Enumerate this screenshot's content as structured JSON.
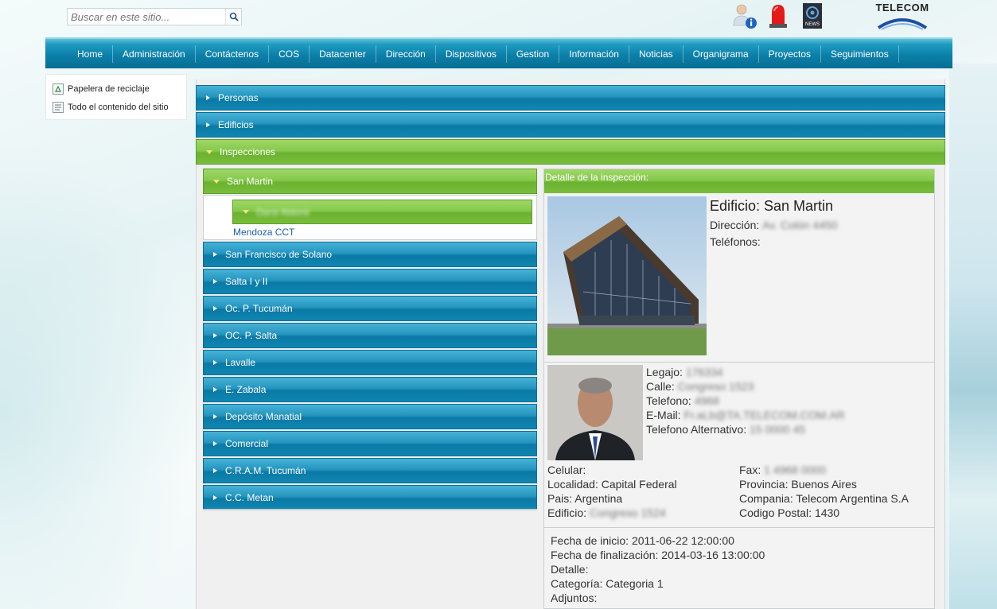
{
  "search": {
    "placeholder": "Buscar en este sitio..."
  },
  "header": {
    "icons": [
      "user-info-icon",
      "alarm-siren-icon",
      "news-icon"
    ],
    "logo_text": "TELECOM"
  },
  "nav": {
    "items": [
      "Home",
      "Administración",
      "Contáctenos",
      "COS",
      "Datacenter",
      "Dirección",
      "Dispositivos",
      "Gestion",
      "Información",
      "Noticias",
      "Organigrama",
      "Proyectos",
      "Seguimientos"
    ]
  },
  "quick_links": {
    "recycle": "Papelera de reciclaje",
    "all_content": "Todo el contenido del sitio"
  },
  "accordion": {
    "personas": "Personas",
    "edificios": "Edificios",
    "inspecciones": "Inspecciones"
  },
  "inspections": {
    "expanded": "San Martin",
    "nested_blurred": "Darsi Aldonii",
    "mendoza": "Mendoza CCT",
    "items": [
      "San Francisco de Solano",
      "Salta I y II",
      "Oc. P. Tucumán",
      "OC. P. Salta",
      "Lavalle",
      "E. Zabala",
      "Depósito Manatial",
      "Comercial",
      "C.R.A.M. Tucumán",
      "C.C. Metan"
    ]
  },
  "detail": {
    "header": "Detalle de la inspección:",
    "building_title": "Edificio: San Martin",
    "direccion_label": "Dirección:",
    "direccion_value": "Av. Colón 4450",
    "telefonos_label": "Teléfonos:",
    "person": {
      "legajo_label": "Legajo:",
      "legajo_value": "176334",
      "calle_label": "Calle:",
      "calle_value": "Congreso 1523",
      "telefono_label": "Telefono:",
      "telefono_value": "4968",
      "email_label": "E-Mail:",
      "email_value": "Fr.aLb@TA.TELECOM.COM.AR",
      "telalt_label": "Telefono Alternativo:",
      "telalt_value": "15 0000 45",
      "celular_label": "Celular:",
      "fax_label": "Fax:",
      "fax_value": "1 4968 0000",
      "localidad": "Localidad: Capital Federal",
      "provincia": "Provincia: Buenos Aires",
      "pais": "Pais: Argentina",
      "compania": "Compania: Telecom Argentina S.A",
      "edificio_label": "Edificio:",
      "edificio_value": "Congreso 1524",
      "codigo_postal": "Codigo Postal: 1430"
    },
    "inspection": {
      "inicio": "Fecha de inicio: 2011-06-22 12:00:00",
      "fin": "Fecha de finalización: 2014-03-16 13:00:00",
      "detalle": "Detalle:",
      "categoria": "Categoría: Categoria 1",
      "adjuntos": "Adjuntos:"
    }
  }
}
